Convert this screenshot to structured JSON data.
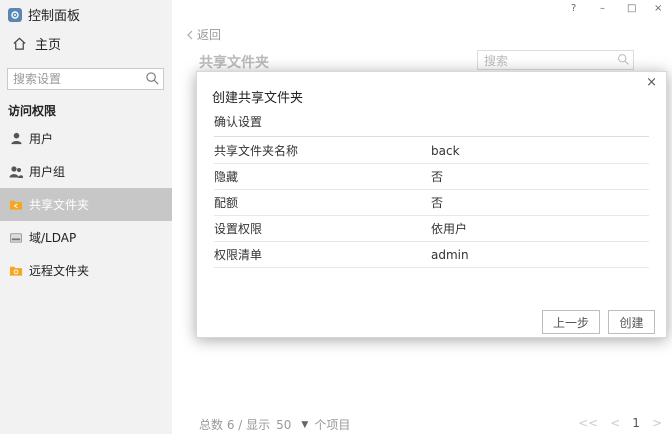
{
  "sidebar": {
    "app_title": "控制面板",
    "home_label": "主页",
    "search_placeholder": "搜索设置",
    "section_title": "访问权限",
    "items": [
      {
        "label": "用户",
        "icon": "user-icon"
      },
      {
        "label": "用户组",
        "icon": "user-group-icon"
      },
      {
        "label": "共享文件夹",
        "icon": "shared-folder-icon",
        "active": true
      },
      {
        "label": "域/LDAP",
        "icon": "ldap-icon"
      },
      {
        "label": "远程文件夹",
        "icon": "remote-folder-icon"
      }
    ]
  },
  "window_controls": {
    "help": "?",
    "minimize": "–",
    "maximize": "□",
    "close": "×"
  },
  "main": {
    "back_label": "返回",
    "page_title": "共享文件夹",
    "search_placeholder": "搜索",
    "footer": {
      "total_label": "总数 6 / 显示",
      "page_size": "50",
      "items_label": "个项目"
    },
    "pager": {
      "first": "<<",
      "prev": "<",
      "current": "1",
      "next": ">"
    }
  },
  "modal": {
    "close_glyph": "×",
    "title": "创建共享文件夹",
    "subtitle": "确认设置",
    "rows": [
      {
        "key": "共享文件夹名称",
        "value": "back"
      },
      {
        "key": "隐藏",
        "value": "否"
      },
      {
        "key": "配额",
        "value": "否"
      },
      {
        "key": "设置权限",
        "value": "依用户"
      },
      {
        "key": "权限清单",
        "value": "admin"
      }
    ],
    "prev_button": "上一步",
    "create_button": "创建"
  },
  "colors": {
    "sidebar_bg": "#f2f2f2",
    "active_item_bg": "#c7c7c7",
    "folder_orange": "#f5a623"
  }
}
